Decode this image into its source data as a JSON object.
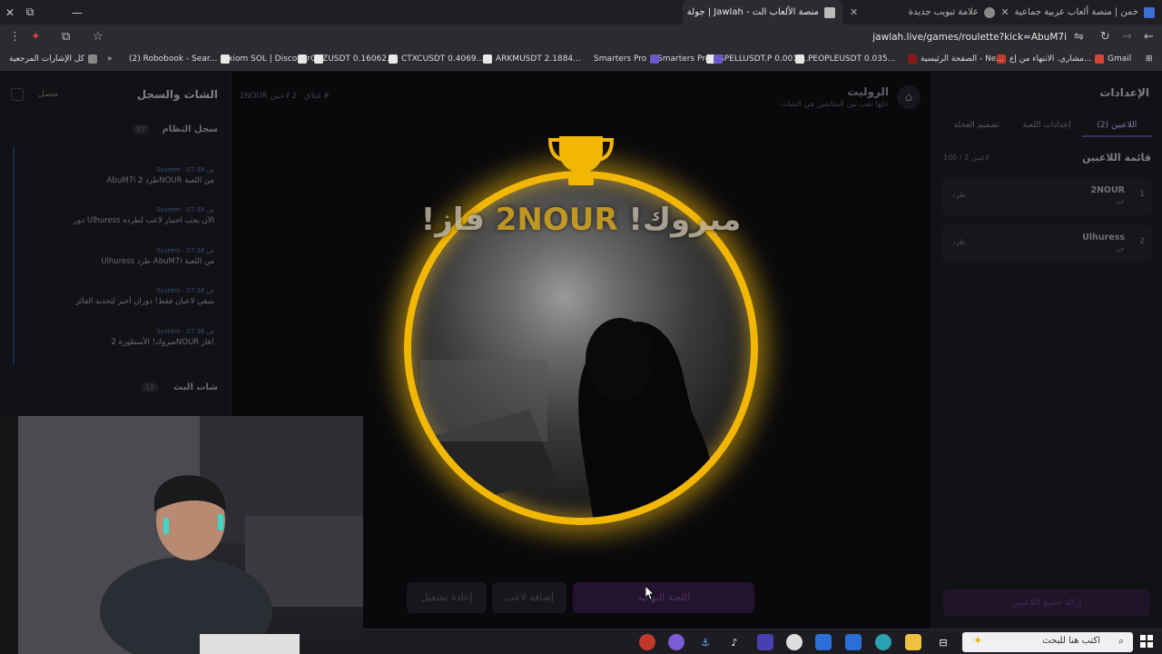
{
  "browser": {
    "tabs": [
      {
        "title": "خمن | منصة ألعاب عربية جماعية",
        "active": false,
        "favicon_color": "#3b6fd6"
      },
      {
        "title": "علامة تبويب جديدة",
        "active": false,
        "favicon_color": "#888888"
      },
      {
        "title": "جولة | Jawlah - منصة الألعاب الت",
        "active": true,
        "favicon_color": "#bbbbbb"
      }
    ],
    "url": "jawlah.live/games/roulette?kick=AbuM7i",
    "bookmarks": [
      {
        "label": "Gmail",
        "icon_color": "#d44638"
      },
      {
        "label": "مشاري. الانتهاء من إع...",
        "icon_color": "#c0392b"
      },
      {
        "label": "الصفحة الرئيسية - Ne...",
        "icon_color": "#8a1a1a"
      },
      {
        "label": "PEOPLEUSDT 0.035...",
        "icon_color": "#e8e8e8"
      },
      {
        "label": "SPELLUSDT.P 0.0011...",
        "icon_color": "#e8e8e8"
      },
      {
        "label": "Smarters Pro",
        "icon_color": "#6a5acd"
      },
      {
        "label": "Smarters Pro",
        "icon_color": "#6a5acd"
      },
      {
        "label": "ARKMUSDT 2.1884...",
        "icon_color": "#e8e8e8"
      },
      {
        "label": "CTXCUSDT 0.4069...",
        "icon_color": "#e8e8e8"
      },
      {
        "label": "CHZUSDT 0.16062...",
        "icon_color": "#e8e8e8"
      },
      {
        "label": "Axiom SOL | Discover",
        "icon_color": "#e8e8e8"
      },
      {
        "label": "(2) Robobook - Sear...",
        "icon_color": "#e8e8e8"
      },
      {
        "label": "كل الإشارات المرجعية",
        "icon_color": "#888888"
      }
    ]
  },
  "left_panel": {
    "title": "الشات والسجل",
    "connection": "متصل",
    "system_log_title": "سجل النظام",
    "system_log_count": "97",
    "log": [
      {
        "meta": "System · 07:38 ص",
        "msg": "AbuM7i طرد 2NOUR من اللعبة"
      },
      {
        "meta": "System · 07:38 ص",
        "msg": "دور Ulhuress الآن يجب اختيار لاعب لطرده"
      },
      {
        "meta": "System · 07:38 ص",
        "msg": "Ulhuress طرد AbuM7i من اللعبة"
      },
      {
        "meta": "System · 07:38 ص",
        "msg": "يتبقى لاعبان فقط! دوران أخير لتحديد الفائز"
      },
      {
        "meta": "System · 07:38 ص",
        "msg": "مبروك! الأسطورة 2NOUR فاز!"
      }
    ],
    "chat_title": "شات البث",
    "chat_count": "12"
  },
  "center": {
    "title": "الروليت",
    "subtitle": "خلها تقب بين المتابعين في الشات",
    "breadcrumb": "2NOUR  فتلاق  · 2 لاعبين #",
    "congrats_prefix": "مبروك!",
    "winner_name": "2NOUR",
    "congrats_suffix": "فاز!",
    "buttons": {
      "start": "اللعبة النهائية",
      "add_player": "إضافة لاعب",
      "replay": "إعادة تشغيل"
    },
    "ring_color": "#f2b705"
  },
  "right_panel": {
    "title": "الإعدادات",
    "tabs": [
      "اللاعبين (2)",
      "إعدادات اللعبة",
      "تصميم العجلة"
    ],
    "list_title": "قائمة اللاعبين",
    "count": "100 / 2 لاعبين",
    "players": [
      {
        "num": "1",
        "name": "2NOUR",
        "status": "حي",
        "kick": "طرد"
      },
      {
        "num": "2",
        "name": "Ulhuress",
        "status": "حي",
        "kick": "طرد"
      }
    ],
    "remove_all": "إزالة جميع اللاعبين"
  },
  "taskbar": {
    "search_placeholder": "اكتب هنا للبحث"
  }
}
